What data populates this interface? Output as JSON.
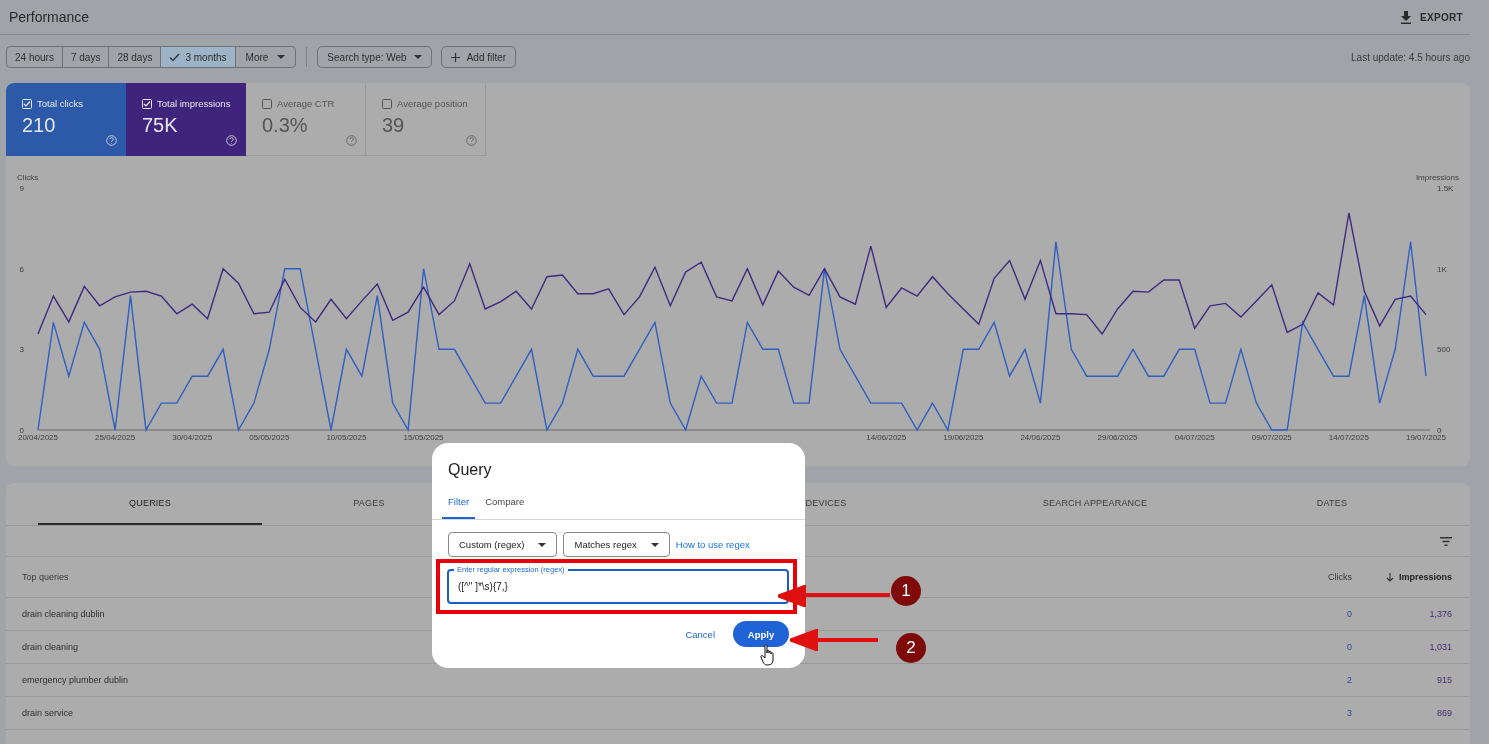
{
  "header": {
    "title": "Performance",
    "export_label": "EXPORT"
  },
  "filters": {
    "ranges": [
      {
        "label": "24 hours",
        "selected": false,
        "kind": "plain"
      },
      {
        "label": "7 days",
        "selected": false,
        "kind": "plain"
      },
      {
        "label": "28 days",
        "selected": false,
        "kind": "plain"
      },
      {
        "label": "3 months",
        "selected": true,
        "kind": "plain"
      },
      {
        "label": "More",
        "selected": false,
        "kind": "dropdown"
      }
    ],
    "search_type": "Search type: Web",
    "add_filter": "Add filter",
    "last_update": "Last update: 4.5 hours ago"
  },
  "metrics": [
    {
      "label": "Total clicks",
      "value": "210",
      "checked": true,
      "color": "#2d5aa8"
    },
    {
      "label": "Total impressions",
      "value": "75K",
      "checked": true,
      "color": "#40237a"
    },
    {
      "label": "Average CTR",
      "value": "0.3%",
      "checked": false
    },
    {
      "label": "Average position",
      "value": "39",
      "checked": false
    }
  ],
  "chart": {
    "chart_data": {
      "type": "line",
      "categories": [
        "20/04/2025",
        null,
        null,
        null,
        null,
        "25/04/2025",
        null,
        null,
        null,
        null,
        "30/04/2025",
        null,
        null,
        null,
        null,
        "05/05/2025",
        null,
        null,
        null,
        null,
        "10/05/2025",
        null,
        null,
        null,
        null,
        "15/05/2025",
        null,
        null,
        null,
        null,
        null,
        null,
        null,
        null,
        null,
        null,
        null,
        null,
        null,
        null,
        null,
        null,
        null,
        null,
        null,
        null,
        null,
        null,
        null,
        null,
        null,
        null,
        null,
        null,
        null,
        "14/06/2025",
        null,
        null,
        null,
        null,
        "19/06/2025",
        null,
        null,
        null,
        null,
        "24/06/2025",
        null,
        null,
        null,
        null,
        "29/06/2025",
        null,
        null,
        null,
        null,
        "04/07/2025",
        null,
        null,
        null,
        null,
        "09/07/2025",
        null,
        null,
        null,
        null,
        "14/07/2025",
        null,
        null,
        null,
        null,
        "19/07/2025"
      ],
      "ylabel": "Clicks",
      "y2label": "Impressions",
      "ylim": [
        0,
        9
      ],
      "y2lim": [
        0,
        1500
      ],
      "yticks": [
        0,
        3,
        6,
        9
      ],
      "y2ticks": [
        {
          "value": 0,
          "label": "0"
        },
        {
          "value": 500,
          "label": "500"
        },
        {
          "value": 1000,
          "label": "1K"
        },
        {
          "value": 1500,
          "label": "1.5K"
        }
      ],
      "series": [
        {
          "color": "#2f5fc0",
          "values": [
            0,
            4,
            2,
            4,
            3,
            0,
            5,
            0,
            1,
            1,
            2,
            2,
            3,
            0,
            1,
            3,
            6,
            6,
            3,
            0,
            3,
            2,
            5,
            1,
            0,
            6,
            3,
            3,
            2,
            1,
            1,
            2,
            3,
            0,
            1,
            3,
            2,
            2,
            2,
            3,
            4,
            1,
            0,
            2,
            1,
            1,
            4,
            3,
            3,
            1,
            1,
            6,
            3,
            2,
            1,
            1,
            1,
            0,
            1,
            0,
            3,
            3,
            4,
            2,
            3,
            1,
            7,
            3,
            2,
            2,
            2,
            3,
            2,
            2,
            3,
            3,
            1,
            1,
            3,
            1,
            0,
            0,
            4,
            3,
            2,
            2,
            5,
            1,
            3,
            7,
            2
          ]
        },
        {
          "axis": "y2",
          "color": "#3f2a80",
          "values": [
            595,
            830,
            670,
            890,
            770,
            825,
            855,
            860,
            830,
            720,
            780,
            690,
            1000,
            910,
            720,
            730,
            935,
            760,
            670,
            810,
            690,
            800,
            905,
            680,
            730,
            885,
            715,
            800,
            1030,
            750,
            795,
            860,
            750,
            950,
            960,
            845,
            845,
            875,
            715,
            825,
            1010,
            770,
            980,
            1040,
            825,
            800,
            1000,
            775,
            985,
            885,
            835,
            1000,
            825,
            780,
            1140,
            760,
            880,
            830,
            950,
            845,
            750,
            655,
            940,
            1050,
            810,
            1050,
            720,
            720,
            715,
            595,
            750,
            860,
            855,
            930,
            930,
            630,
            770,
            785,
            700,
            800,
            900,
            605,
            655,
            850,
            775,
            1345,
            860,
            645,
            810,
            830,
            715
          ]
        }
      ]
    }
  },
  "table": {
    "tabs": [
      {
        "label": "QUERIES",
        "selected": true
      },
      {
        "label": "PAGES",
        "selected": false
      },
      {
        "label": "DEVICES",
        "selected": false
      },
      {
        "label": "SEARCH APPEARANCE",
        "selected": false
      },
      {
        "label": "DATES",
        "selected": false
      }
    ],
    "columns": [
      {
        "label": "Top queries",
        "sorted": false
      },
      {
        "label": "Clicks",
        "sorted": false
      },
      {
        "label": "Impressions",
        "sorted": true
      }
    ],
    "rows": [
      [
        "drain cleaning dublin",
        "0",
        "1,376"
      ],
      [
        "drain cleaning",
        "0",
        "1,031"
      ],
      [
        "emergency plumber dublin",
        "2",
        "915"
      ],
      [
        "drain service",
        "3",
        "869"
      ]
    ]
  },
  "dialog": {
    "title": "Query",
    "tabs": [
      {
        "label": "Filter",
        "selected": true
      },
      {
        "label": "Compare",
        "selected": false
      }
    ],
    "dropdowns": [
      "Custom (regex)",
      "Matches regex"
    ],
    "help_link": "How to use regex",
    "field": {
      "label": "Enter regular expression (regex)",
      "value": "([^\" ]*\\s){7,}"
    },
    "cancel": "Cancel",
    "apply": "Apply"
  },
  "annotations": [
    {
      "label": "1"
    },
    {
      "label": "2"
    }
  ]
}
